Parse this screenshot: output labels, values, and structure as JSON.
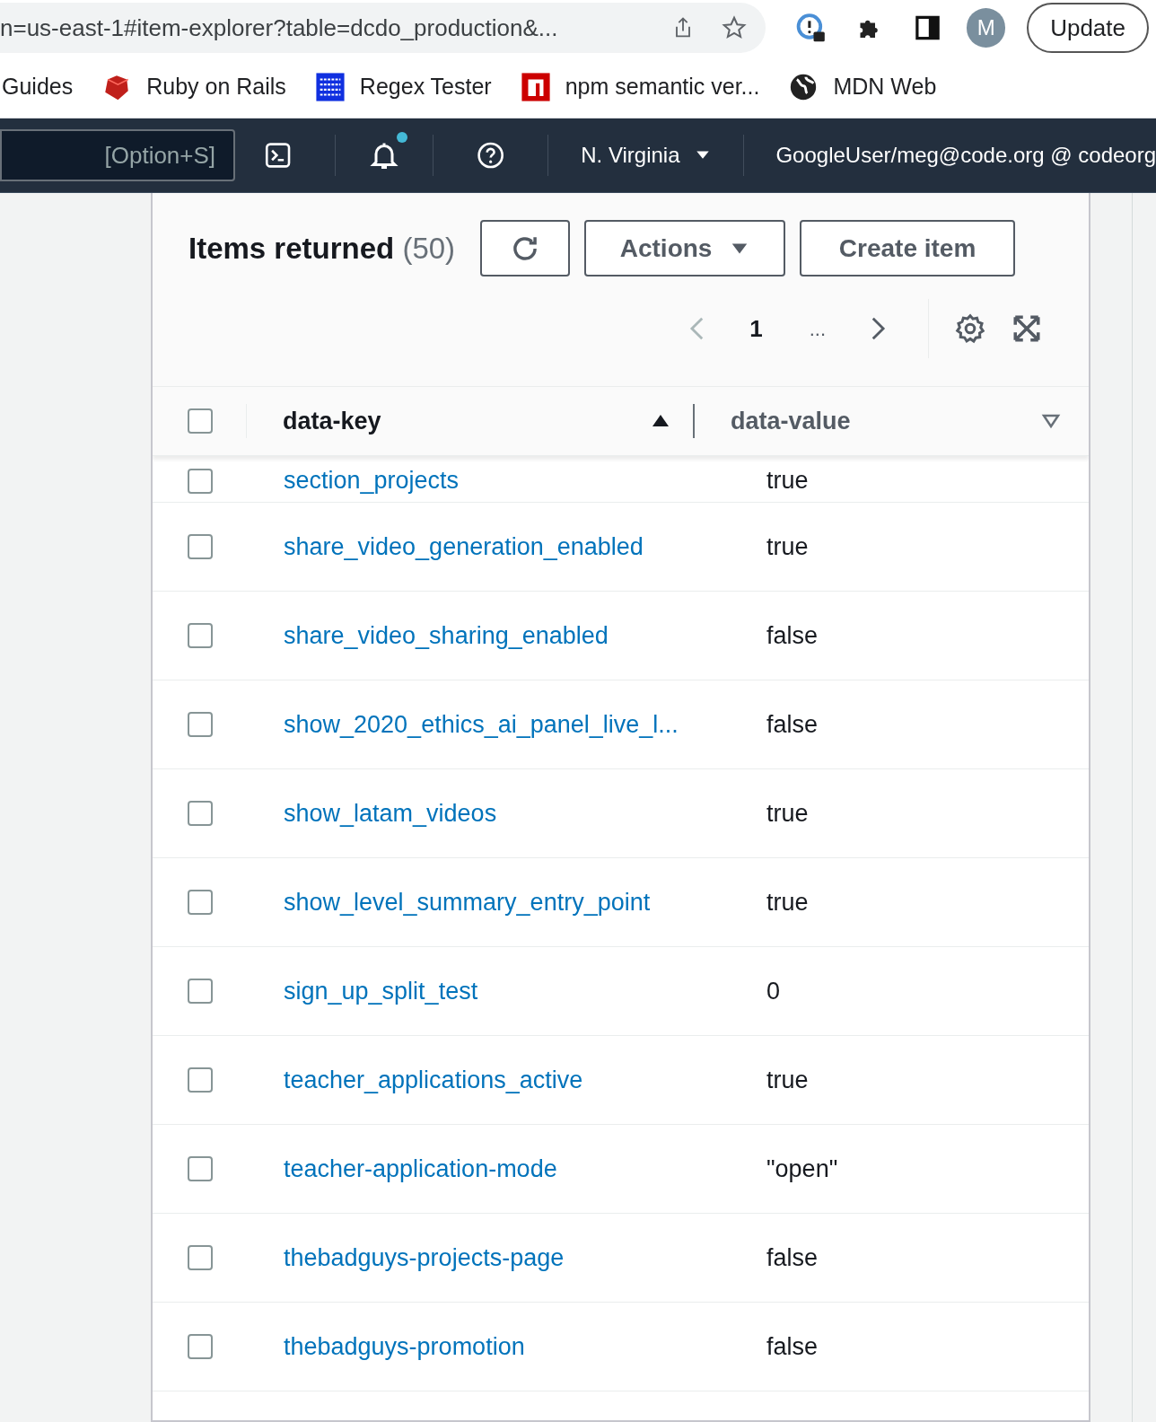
{
  "browser": {
    "url": "n=us-east-1#item-explorer?table=dcdo_production&...",
    "profile_initial": "M",
    "update_button": "Update"
  },
  "bookmarks": [
    "Guides",
    "Ruby on Rails",
    "Regex Tester",
    "npm semantic ver...",
    "MDN Web"
  ],
  "top_nav": {
    "search_shortcut": "[Option+S]",
    "notifications_unread": true,
    "region": "N. Virginia",
    "account": "GoogleUser/meg@code.org @ codeorg"
  },
  "panel": {
    "title": "Items returned",
    "count": "(50)",
    "actions_button": "Actions",
    "create_button": "Create item",
    "page": "1",
    "ellipsis": "..."
  },
  "table": {
    "columns": [
      {
        "label": "data-key",
        "sorted": true
      },
      {
        "label": "data-value",
        "sorted": false
      }
    ],
    "select_all_checked": false,
    "rows": [
      {
        "key": "section_projects",
        "value": "true",
        "checked": false
      },
      {
        "key": "share_video_generation_enabled",
        "value": "true",
        "checked": false
      },
      {
        "key": "share_video_sharing_enabled",
        "value": "false",
        "checked": false
      },
      {
        "key": "show_2020_ethics_ai_panel_live_l...",
        "value": "false",
        "checked": false
      },
      {
        "key": "show_latam_videos",
        "value": "true",
        "checked": false
      },
      {
        "key": "show_level_summary_entry_point",
        "value": "true",
        "checked": false
      },
      {
        "key": "sign_up_split_test",
        "value": "0",
        "checked": false
      },
      {
        "key": "teacher_applications_active",
        "value": "true",
        "checked": false
      },
      {
        "key": "teacher-application-mode",
        "value": "\"open\"",
        "checked": false
      },
      {
        "key": "thebadguys-projects-page",
        "value": "false",
        "checked": false
      },
      {
        "key": "thebadguys-promotion",
        "value": "false",
        "checked": false
      }
    ]
  }
}
